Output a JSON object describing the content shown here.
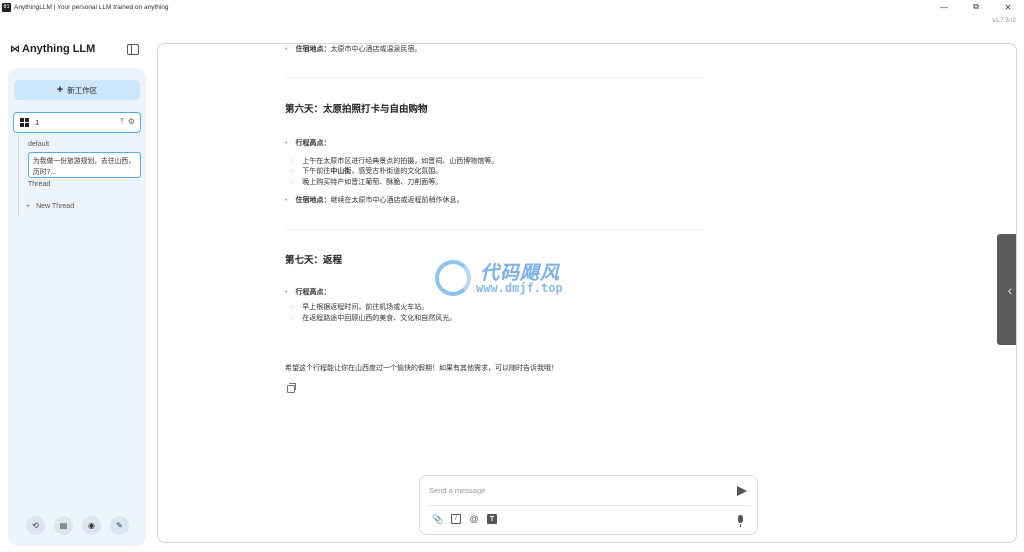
{
  "window": {
    "app_icon": "01",
    "title": "AnythingLLM | Your personal LLM trained on anything",
    "minimize": "—",
    "maximize": "⧉",
    "close": "✕",
    "version": "v1.7.3-r2"
  },
  "sidebar": {
    "logo_mark": "⋈",
    "logo_text": "Anything LLM",
    "new_workspace_label": "新工作区",
    "workspace": {
      "name": "1",
      "upload_icon": "⤒",
      "settings_icon": "⚙"
    },
    "threads": {
      "default": "default",
      "active": "为我做一份旅游规划，去往山西，历时7...",
      "plain": "Thread"
    },
    "new_thread_label": "New Thread",
    "bottom_icons": [
      "community-icon",
      "docs-icon",
      "discord-icon",
      "settings-wrench-icon"
    ]
  },
  "chat": {
    "lines": {
      "l1_label": "住宿地点：",
      "l1_text": "太原市中心酒店或温泉民宿。",
      "day6_title": "第六天：太原拍照打卡与自由购物",
      "d6_highlights_label": "行程高点：",
      "d6_item1": "上午在太原市区进行经典景点的拍摄，如晋祠、山西博物馆等。",
      "d6_item2_pre": "下午前往",
      "d6_item2_bold": "中山街",
      "d6_item2_post": "，感受古朴街道的文化氛围。",
      "d6_item3": "晚上购买特产如晋江葡萄、酥脆、刀削面等。",
      "d6_stay_label": "住宿地点：",
      "d6_stay_text": "继续在太原市中心酒店或返程前稍作休息。",
      "day7_title": "第七天：返程",
      "d7_highlights_label": "行程高点：",
      "d7_item1": "早上根据返程时间，前往机场或火车站。",
      "d7_item2": "在返程路途中回顾山西的美食、文化和自然风光。",
      "closing": "希望这个行程能让你在山西度过一个愉快的假期！如果有其他需求，可以随时告诉我哦！"
    },
    "watermark": {
      "title": "代码飓风",
      "url": "www.dmjf.top"
    },
    "collapse_chevron": "‹"
  },
  "composer": {
    "placeholder": "Send a message",
    "tools": {
      "attach": "📎",
      "slash": "/",
      "at": "@",
      "text": "T"
    }
  }
}
